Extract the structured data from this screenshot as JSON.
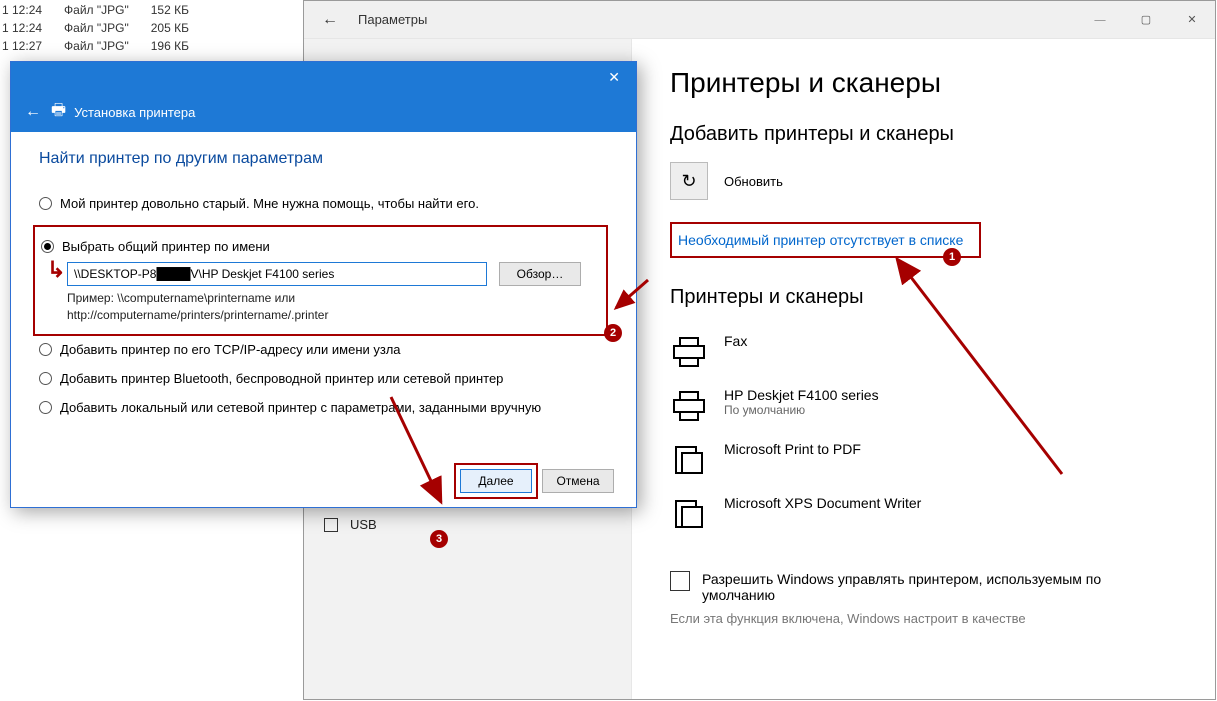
{
  "bg_files": {
    "rows": [
      {
        "time": "1 12:24",
        "type": "Файл \"JPG\"",
        "size": "152 КБ"
      },
      {
        "time": "1 12:24",
        "type": "Файл \"JPG\"",
        "size": "205 КБ"
      },
      {
        "time": "1 12:27",
        "type": "Файл \"JPG\"",
        "size": "196 КБ"
      }
    ]
  },
  "settings": {
    "back_arrow": "←",
    "title": "Параметры",
    "win": {
      "min": "—",
      "max": "▢",
      "close": "✕"
    },
    "side": {
      "usb": "USB"
    },
    "main": {
      "h1": "Принтеры и сканеры",
      "add_h": "Добавить принтеры и сканеры",
      "refresh": "Обновить",
      "refresh_icon": "↻",
      "missing": "Необходимый принтер отсутствует в списке",
      "list_h": "Принтеры и сканеры",
      "printers": [
        {
          "name": "Fax",
          "sub": ""
        },
        {
          "name": "HP Deskjet F4100 series",
          "sub": "По умолчанию"
        },
        {
          "name": "Microsoft Print to PDF",
          "sub": ""
        },
        {
          "name": "Microsoft XPS Document Writer",
          "sub": ""
        }
      ],
      "chk_label": "Разрешить Windows управлять принтером, используемым по умолчанию",
      "hint": "Если эта функция включена, Windows настроит в качестве"
    }
  },
  "wizard": {
    "title": "Установка принтера",
    "close": "✕",
    "back": "←",
    "heading": "Найти принтер по другим параметрам",
    "opt_old": "Мой принтер довольно старый. Мне нужна помощь, чтобы найти его.",
    "opt_share": "Выбрать общий принтер по имени",
    "share_value": "\\\\DESKTOP-P8████V\\HP Deskjet F4100 series",
    "browse": "Обзор…",
    "example1": "Пример: \\\\computername\\printername или",
    "example2": "http://computername/printers/printername/.printer",
    "opt_tcp": "Добавить принтер по его TCP/IP-адресу или имени узла",
    "opt_bt": "Добавить принтер Bluetooth, беспроводной принтер или сетевой принтер",
    "opt_local": "Добавить локальный или сетевой принтер с параметрами, заданными вручную",
    "next": "Далее",
    "cancel": "Отмена"
  },
  "badges": {
    "b1": "1",
    "b2": "2",
    "b3": "3"
  }
}
